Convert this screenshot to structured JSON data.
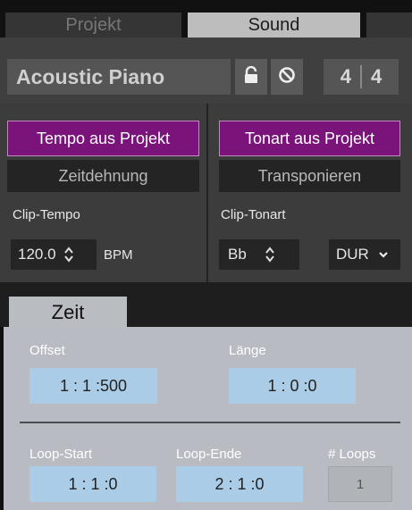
{
  "tabs": {
    "projekt": "Projekt",
    "sound": "Sound"
  },
  "header": {
    "clip_name": "Acoustic Piano",
    "lock_icon": "lock-open-icon",
    "ban_icon": "ban-icon",
    "time_sig_numerator": "4",
    "time_sig_denominator": "4"
  },
  "tempo": {
    "from_project_label": "Tempo aus Projekt",
    "stretch_label": "Zeitdehnung",
    "clip_tempo_label": "Clip-Tempo",
    "value": "120.0",
    "unit": "BPM"
  },
  "key": {
    "from_project_label": "Tonart aus Projekt",
    "transpose_label": "Transponieren",
    "clip_key_label": "Clip-Tonart",
    "value": "Bb",
    "mode": "DUR"
  },
  "time_panel": {
    "tab_label": "Zeit",
    "offset_label": "Offset",
    "offset_value": "1 : 1 :500",
    "length_label": "Länge",
    "length_value": "1 : 0 :0",
    "loop_start_label": "Loop-Start",
    "loop_start_value": "1 : 1 :0",
    "loop_end_label": "Loop-Ende",
    "loop_end_value": "2 : 1 :0",
    "loops_label": "# Loops",
    "loops_value": "1"
  },
  "colors": {
    "accent_purple": "#7a137a",
    "value_box_blue": "#aacce6"
  }
}
